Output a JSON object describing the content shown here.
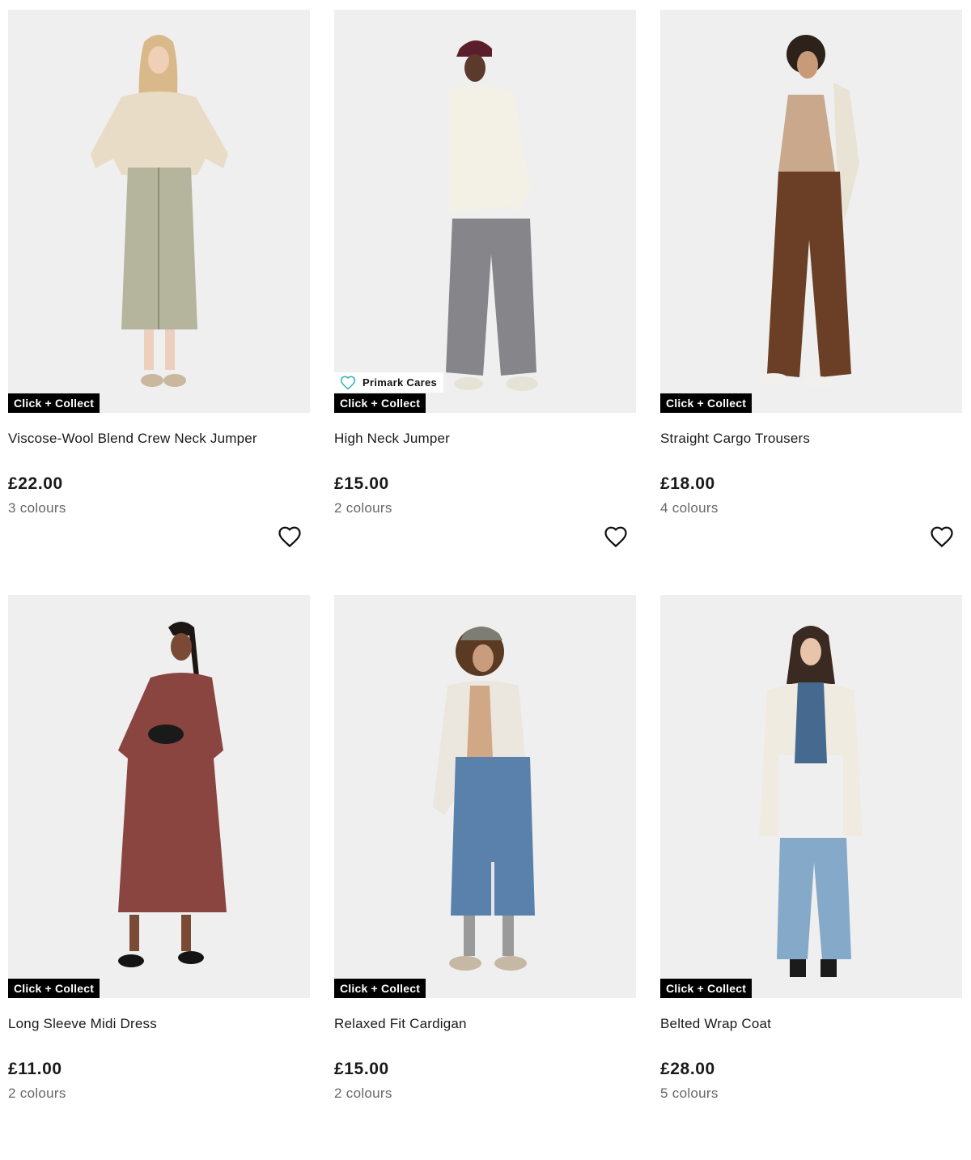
{
  "products": [
    {
      "badge": "Click + Collect",
      "title": "Viscose-Wool Blend Crew Neck Jumper",
      "price": "£22.00",
      "colours": "3 colours",
      "icon": "heart-icon"
    },
    {
      "badge": "Click + Collect",
      "tag": "Primark Cares",
      "title": "High Neck Jumper",
      "price": "£15.00",
      "colours": "2 colours",
      "icon": "heart-icon"
    },
    {
      "badge": "Click + Collect",
      "title": "Straight Cargo Trousers",
      "price": "£18.00",
      "colours": "4 colours",
      "icon": "heart-icon"
    },
    {
      "badge": "Click + Collect",
      "title": "Long Sleeve Midi Dress",
      "price": "£11.00",
      "colours": "2 colours"
    },
    {
      "badge": "Click + Collect",
      "title": "Relaxed Fit Cardigan",
      "price": "£15.00",
      "colours": "2 colours"
    },
    {
      "badge": "Click + Collect",
      "title": "Belted Wrap Coat",
      "price": "£28.00",
      "colours": "5 colours"
    }
  ],
  "colors": {
    "badge_bg": "#000000",
    "badge_text": "#ffffff",
    "image_bg": "#efefef",
    "cares_accent": "#2ab3b1"
  }
}
